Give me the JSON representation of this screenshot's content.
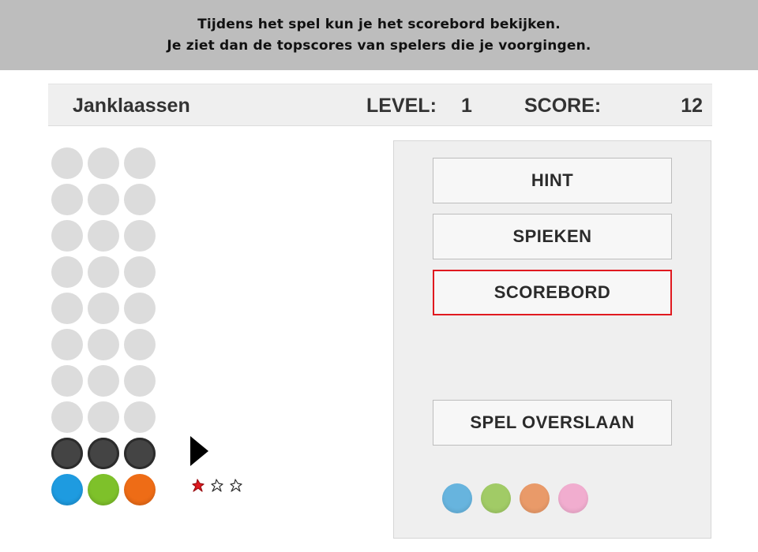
{
  "banner": {
    "line1": "Tijdens het spel kun je het scorebord bekijken.",
    "line2": "Je ziet dan de topscores van spelers die je voorgingen."
  },
  "header": {
    "player_name": "Janklaassen",
    "level_label": "LEVEL:",
    "level_value": "1",
    "score_label": "SCORE:",
    "score_value": "12"
  },
  "board": {
    "empty_color": "#dcdcdc",
    "empty_rows": 8,
    "columns": 3,
    "guess_row": [
      "#444444",
      "#444444",
      "#444444"
    ],
    "selected_row": [
      "#1e9be0",
      "#7ec12a",
      "#ee6c16"
    ],
    "feedback": [
      "pin-red-icon",
      "pin-outline-icon",
      "pin-outline-icon"
    ]
  },
  "panel": {
    "hint_label": "HINT",
    "spieken_label": "SPIEKEN",
    "scorebord_label": "SCOREBORD",
    "overslaan_label": "SPEL OVERSLAAN",
    "highlight_color": "#e0191f",
    "palette": [
      "#67b4de",
      "#a1cb66",
      "#e99a69",
      "#f1adcf"
    ]
  }
}
